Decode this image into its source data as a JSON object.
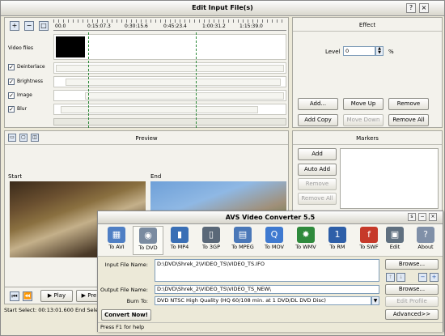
{
  "main_window": {
    "title": "Edit Input File(s)",
    "timeline": {
      "ticks": [
        "00.0",
        "0:15:07.3",
        "0:30:15.6",
        "0:45:23.4",
        "1:00:31.2",
        "1:15:39.0"
      ],
      "video_files_label": "Video files",
      "effect_rows": [
        {
          "label": "Deinterlace",
          "checked": true
        },
        {
          "label": "Brightness",
          "checked": true
        },
        {
          "label": "Image",
          "checked": true
        },
        {
          "label": "Blur",
          "checked": true
        }
      ]
    },
    "effect": {
      "header": "Effect",
      "level_label": "Level",
      "level_value": "0",
      "unit": "%",
      "add": "Add...",
      "move_up": "Move Up",
      "remove": "Remove",
      "add_copy": "Add Copy",
      "move_down": "Move Down",
      "remove_all": "Remove All"
    },
    "preview": {
      "header": "Preview",
      "start_label": "Start",
      "end_label": "End"
    },
    "markers": {
      "header": "Markers",
      "add": "Add",
      "auto_add": "Auto Add",
      "remove": "Remove",
      "remove_all": "Remove All"
    },
    "playback": {
      "play": "Play",
      "prev": "Pre"
    },
    "status": "Start Select: 00:13:01.600  End Sele"
  },
  "converter": {
    "title": "AVS Video Converter 5.5",
    "toolbar": [
      {
        "label": "To AVI",
        "icon": "avi-icon",
        "color": "#4f7fc4"
      },
      {
        "label": "To DVD",
        "icon": "dvd-icon",
        "color": "#7a8ba0",
        "selected": true
      },
      {
        "label": "To MP4",
        "icon": "mp4-icon",
        "color": "#3a6fb5"
      },
      {
        "label": "To 3GP",
        "icon": "3gp-icon",
        "color": "#5a6878"
      },
      {
        "label": "To MPEG",
        "icon": "mpeg-icon",
        "color": "#4a78b8"
      },
      {
        "label": "To MOV",
        "icon": "mov-icon",
        "color": "#3f7ad0"
      },
      {
        "label": "To WMV",
        "icon": "wmv-icon",
        "color": "#2f8a3c"
      },
      {
        "label": "To RM",
        "icon": "rm-icon",
        "color": "#2e5fa8"
      },
      {
        "label": "To SWF",
        "icon": "swf-icon",
        "color": "#c63a2a"
      },
      {
        "label": "Edit",
        "icon": "edit-icon",
        "color": "#607080"
      },
      {
        "label": "About",
        "icon": "about-icon",
        "color": "#8090a8"
      }
    ],
    "input_label": "Input File Name:",
    "input_value": "D:\\DVD\\Shrek_2\\VIDEO_TS\\VIDEO_TS.IFO",
    "output_label": "Output File Name:",
    "output_value": "D:\\DVD\\Shrek_2\\VIDEO_TS\\VIDEO_TS_NEW\\",
    "burn_label": "Burn To:",
    "burn_value": "DVD NTSC High Quality (HQ 60/108 min. at 1 DVD/DL DVD Disc)",
    "browse1": "Browse...",
    "browse2": "Browse...",
    "edit_profile": "Edit Profile",
    "advanced": "Advanced>>",
    "convert": "Convert Now!",
    "status": "Press F1 for help"
  }
}
